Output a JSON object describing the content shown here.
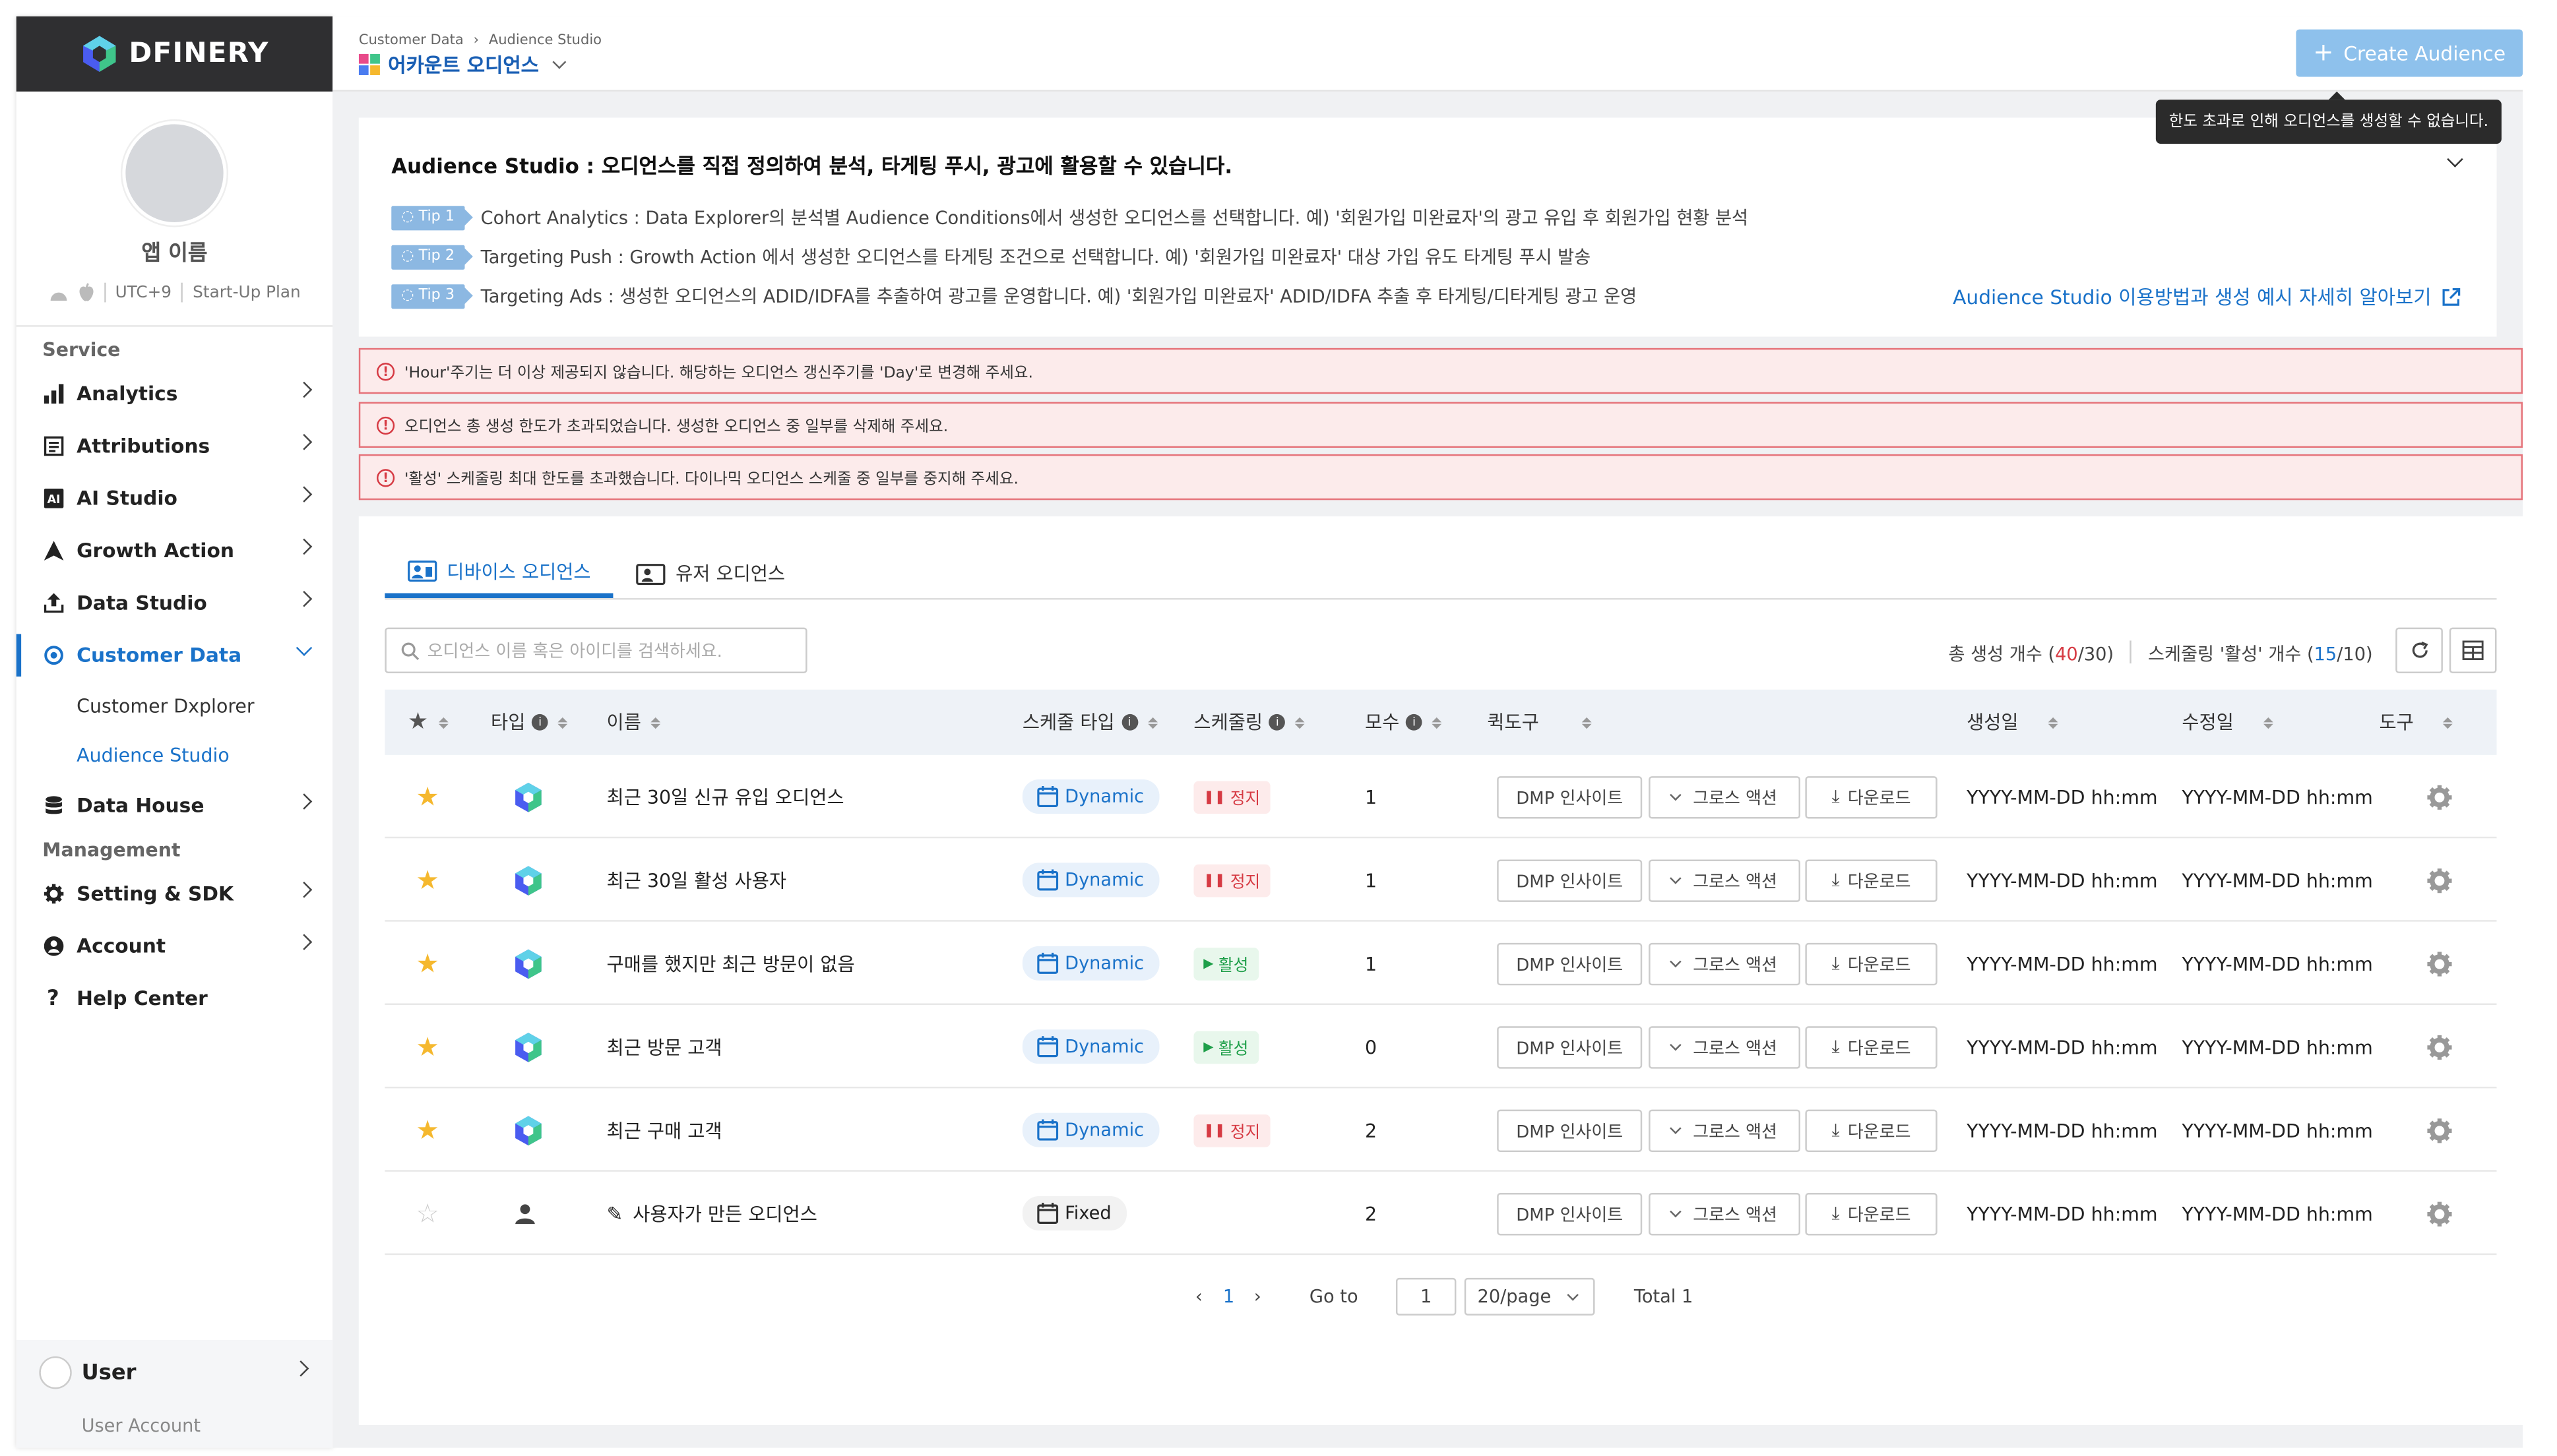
{
  "brand": {
    "name": "DFINERY"
  },
  "profile": {
    "app_name": "앱 이름",
    "timezone": "UTC+9",
    "plan": "Start-Up Plan"
  },
  "nav": {
    "service_heading": "Service",
    "management_heading": "Management",
    "analytics": "Analytics",
    "attributions": "Attributions",
    "ai_studio": "AI Studio",
    "growth_action": "Growth Action",
    "data_studio": "Data Studio",
    "customer_data": "Customer Data",
    "customer_dxplorer": "Customer Dxplorer",
    "audience_studio": "Audience Studio",
    "data_house": "Data House",
    "setting_sdk": "Setting & SDK",
    "account": "Account",
    "help_center": "Help Center"
  },
  "user": {
    "name": "User",
    "account": "User Account"
  },
  "header": {
    "breadcrumb_1": "Customer Data",
    "breadcrumb_2": "Audience Studio",
    "project": "어카운트 오디언스",
    "create_button": "Create Audience",
    "tooltip": "한도 초과로 인해 오디언스를 생성할 수 없습니다."
  },
  "info": {
    "title": "Audience Studio : 오디언스를 직접 정의하여 분석, 타게팅 푸시, 광고에 활용할 수 있습니다.",
    "tips": [
      {
        "badge": "Tip 1",
        "text": "Cohort Analytics : Data Explorer의 분석별 Audience Conditions에서 생성한 오디언스를 선택합니다. 예) '회원가입 미완료자'의 광고 유입 후 회원가입 현황 분석"
      },
      {
        "badge": "Tip 2",
        "text": "Targeting Push : Growth Action 에서 생성한 오디언스를 타게팅 조건으로 선택합니다. 예) '회원가입 미완료자' 대상 가입 유도 타게팅 푸시 발송"
      },
      {
        "badge": "Tip 3",
        "text": "Targeting Ads : 생성한 오디언스의 ADID/IDFA를 추출하여 광고를 운영합니다. 예) '회원가입 미완료자' ADID/IDFA 추출 후 타게팅/디타게팅 광고 운영"
      }
    ],
    "link": "Audience Studio 이용방법과 생성 예시 자세히 알아보기"
  },
  "alerts": [
    "'Hour'주기는 더 이상 제공되지 않습니다. 해당하는 오디언스 갱신주기를 'Day'로 변경해 주세요.",
    "오디언스 총 생성 한도가 초과되었습니다. 생성한 오디언스 중 일부를 삭제해 주세요.",
    "'활성' 스케줄링 최대 한도를 초과했습니다. 다이나믹 오디언스 스케줄 중 일부를 중지해 주세요."
  ],
  "tabs": {
    "device": "디바이스 오디언스",
    "user": "유저 오디언스"
  },
  "search": {
    "placeholder": "오디언스 이름 혹은 아이디를 검색하세요."
  },
  "counts": {
    "total_label": "총 생성 개수 (",
    "total_used": "40",
    "total_limit": "/30)",
    "sched_label": "스케줄링 '활성' 개수 (",
    "sched_used": "15",
    "sched_limit": "/10)"
  },
  "columns": {
    "type": "타입",
    "name": "이름",
    "schedule_type": "스케줄 타입",
    "scheduling": "스케줄링",
    "population": "모수",
    "quick_tools": "퀵도구",
    "created": "생성일",
    "modified": "수정일",
    "tools": "도구"
  },
  "quick": {
    "dmp": "DMP 인사이트",
    "growth": "그로스 액션",
    "download": "다운로드"
  },
  "rows": [
    {
      "starred": true,
      "type_icon": "dfinery-cube-icon",
      "name": "최근 30일 신규 유입 오디언스",
      "schedule_type": "Dynamic",
      "status": "정지",
      "status_kind": "stop",
      "population": "1",
      "created": "YYYY-MM-DD hh:mm",
      "modified": "YYYY-MM-DD hh:mm"
    },
    {
      "starred": true,
      "type_icon": "dfinery-cube-icon",
      "name": "최근 30일 활성 사용자",
      "schedule_type": "Dynamic",
      "status": "정지",
      "status_kind": "stop",
      "population": "1",
      "created": "YYYY-MM-DD hh:mm",
      "modified": "YYYY-MM-DD hh:mm"
    },
    {
      "starred": true,
      "type_icon": "dfinery-cube-icon",
      "name": "구매를 했지만 최근 방문이 없음",
      "schedule_type": "Dynamic",
      "status": "활성",
      "status_kind": "active",
      "population": "1",
      "created": "YYYY-MM-DD hh:mm",
      "modified": "YYYY-MM-DD hh:mm"
    },
    {
      "starred": true,
      "type_icon": "dfinery-cube-icon",
      "name": "최근 방문 고객",
      "schedule_type": "Dynamic",
      "status": "활성",
      "status_kind": "active",
      "population": "0",
      "created": "YYYY-MM-DD hh:mm",
      "modified": "YYYY-MM-DD hh:mm"
    },
    {
      "starred": true,
      "type_icon": "dfinery-cube-icon",
      "name": "최근 구매 고객",
      "schedule_type": "Dynamic",
      "status": "정지",
      "status_kind": "stop",
      "population": "2",
      "created": "YYYY-MM-DD hh:mm",
      "modified": "YYYY-MM-DD hh:mm"
    },
    {
      "starred": false,
      "type_icon": "person-icon",
      "name": "사용자가 만든 오디언스",
      "schedule_type": "Fixed",
      "status": "",
      "status_kind": "",
      "population": "2",
      "created": "YYYY-MM-DD hh:mm",
      "modified": "YYYY-MM-DD hh:mm"
    }
  ],
  "pagination": {
    "current": "1",
    "goto_label": "Go to",
    "goto_value": "1",
    "page_size": "20/page",
    "total": "Total 1"
  },
  "colors": {
    "accent": "#1a72c9",
    "alert_bg": "#fcebeb",
    "alert_border": "#e5737a",
    "stop": "#d63a43",
    "active": "#1f9f4a",
    "create_btn": "#8ec1ec"
  }
}
